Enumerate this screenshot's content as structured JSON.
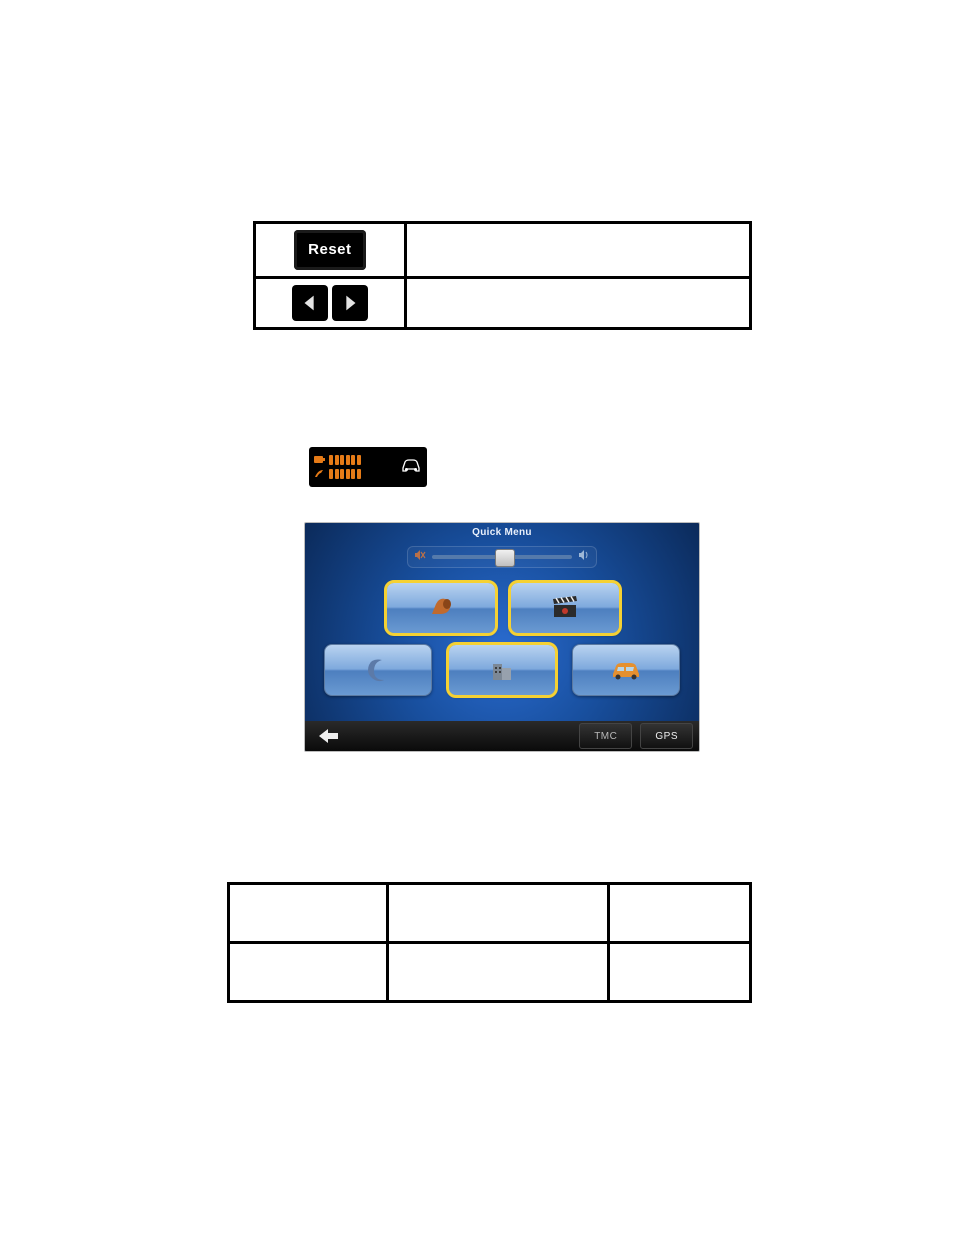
{
  "reset_label": "Reset",
  "quick_menu": {
    "title": "Quick Menu",
    "tmc_label": "TMC",
    "gps_label": "GPS"
  },
  "icons": {
    "left_arrow": "prev-arrow-icon",
    "right_arrow": "next-arrow-icon",
    "mute": "speaker-mute-icon",
    "volume": "speaker-icon",
    "loudspeaker": "loudspeaker-icon",
    "clapboard": "clapboard-icon",
    "moon": "moon-icon",
    "buildings": "buildings-icon",
    "car": "car-icon",
    "back": "back-arrow-icon",
    "battery": "battery-icon",
    "satellite": "satellite-icon",
    "car_outline": "car-outline-icon"
  },
  "colors": {
    "accent_orange": "#e67b17",
    "highlight_yellow": "#f5d133",
    "bg_blue": "#184f9e"
  }
}
